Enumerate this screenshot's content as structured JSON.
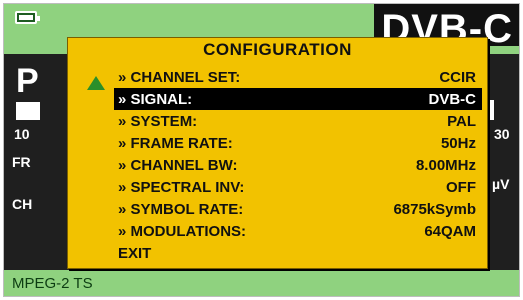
{
  "header": {
    "mode_title": "DVB-C"
  },
  "background": {
    "big_left": "P",
    "big_right": "/",
    "num_left": "10",
    "num_right": "30",
    "label_fr": "FR",
    "label_ch": "CH",
    "unit": "µV"
  },
  "dialog": {
    "title": "CONFIGURATION",
    "items": [
      {
        "label": "» CHANNEL SET:",
        "value": "CCIR"
      },
      {
        "label": "» SIGNAL:",
        "value": "DVB-C"
      },
      {
        "label": "» SYSTEM:",
        "value": "PAL"
      },
      {
        "label": "» FRAME RATE:",
        "value": "50Hz"
      },
      {
        "label": "» CHANNEL BW:",
        "value": "8.00MHz"
      },
      {
        "label": "» SPECTRAL INV:",
        "value": "OFF"
      },
      {
        "label": "» SYMBOL RATE:",
        "value": "6875kSymb"
      },
      {
        "label": "» MODULATIONS:",
        "value": "64QAM"
      },
      {
        "label": "EXIT",
        "value": ""
      }
    ],
    "selected_index": 1
  },
  "status_bar": {
    "text": "MPEG-2 TS"
  },
  "colors": {
    "screen_green": "#8fd27f",
    "dialog_yellow": "#f2c200",
    "selection": "#000000"
  }
}
